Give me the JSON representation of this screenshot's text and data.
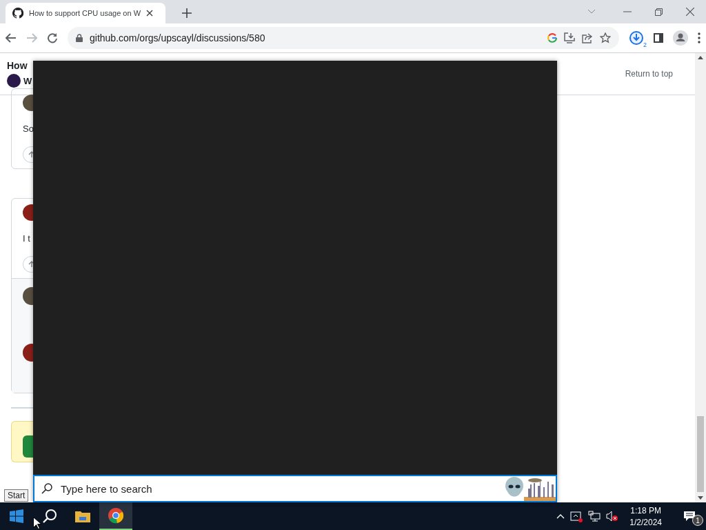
{
  "browser": {
    "tab": {
      "title": "How to support CPU usage on W",
      "selected": true
    },
    "url": "github.com/orgs/upscayl/discussions/580",
    "downloads_count": "2"
  },
  "page": {
    "header": {
      "title": "How",
      "subtitle": "W",
      "return_link": "Return to top"
    },
    "comments": [
      {
        "text": "So"
      },
      {
        "text": "I t"
      }
    ]
  },
  "search_panel": {
    "placeholder": "Type here to search"
  },
  "taskbar": {
    "tooltip": "Start",
    "apps": [
      {
        "kind": "folder",
        "active": false
      },
      {
        "kind": "chrome",
        "active": true
      }
    ],
    "time": "1:18 PM",
    "date": "1/2/2024",
    "notifications": "1"
  }
}
